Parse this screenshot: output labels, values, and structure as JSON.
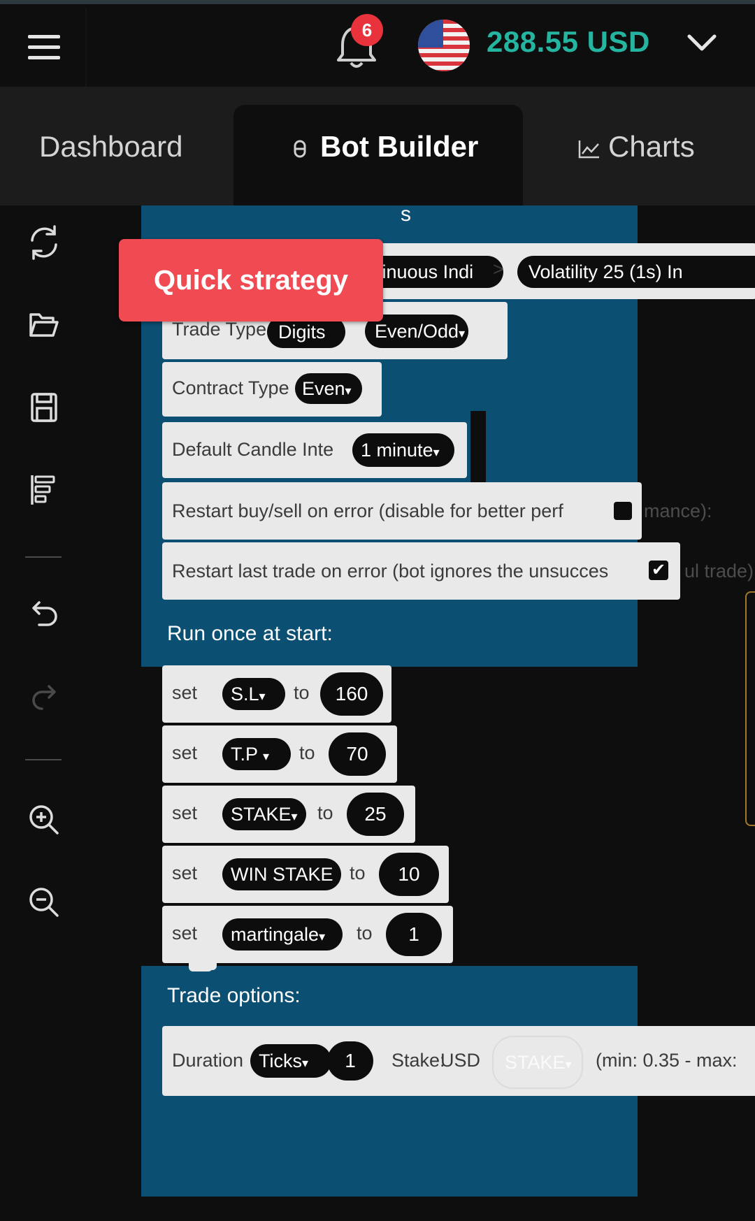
{
  "header": {
    "notification_count": "6",
    "balance": "288.55 USD",
    "flag_icon": "us-flag-icon"
  },
  "tabs": [
    {
      "label": "Dashboard"
    },
    {
      "label": "Bot Builder",
      "icon": "bot-icon"
    },
    {
      "label": "Charts",
      "icon": "chart-icon"
    }
  ],
  "sidebar": {
    "icons": [
      "reset-icon",
      "folder-open-icon",
      "save-icon",
      "sort-icon",
      "undo-icon",
      "redo-icon",
      "zoom-in-icon",
      "zoom-out-icon"
    ]
  },
  "quick_strategy": "Quick strategy",
  "blocks": {
    "header_partial": "s",
    "market_pill_1": "ntinuous Indi",
    "market_sep": ">",
    "market_pill_2": "Volatility 25 (1s) In",
    "trade_type_label": "Trade Type",
    "trade_type_pill_1": "Digits",
    "trade_type_pill_2": "Even/Odd",
    "contract_type_label": "Contract Type",
    "contract_type_value": "Even",
    "candle_label": "Default Candle Inte",
    "candle_value": "1 minute",
    "restart_buy_sell_label": "Restart buy/sell on error (disable for better perf",
    "restart_buy_sell_suffix": "mance):",
    "restart_last_trade_label": "Restart last trade on error (bot ignores the unsucces",
    "restart_last_trade_suffix": "ul trade):",
    "restart_last_trade_checked": "✔",
    "run_once_label": "Run once at start:",
    "set_rows": [
      {
        "set": "set",
        "var": "S.L",
        "to": "to",
        "value": "160"
      },
      {
        "set": "set",
        "var": "T.P",
        "to": "to",
        "value": "70"
      },
      {
        "set": "set",
        "var": "STAKE",
        "to": "to",
        "value": "25"
      },
      {
        "set": "set",
        "var": "WIN STAKE",
        "to": "to",
        "value": "10"
      },
      {
        "set": "set",
        "var": "martingale",
        "to": "to",
        "value": "1"
      }
    ],
    "trade_options_label": "Trade options:",
    "duration_label": "Duration",
    "duration_unit": "Ticks",
    "duration_value": "1",
    "stake_label": "Stake:",
    "stake_currency": "USD",
    "stake_var": "STAKE",
    "stake_range": "(min: 0.35 - max:"
  },
  "colors": {
    "accent_teal": "#24b4a0",
    "block_blue": "#0b4f73",
    "quick_strategy_red": "#f04a52",
    "badge_red": "#e8323c"
  }
}
